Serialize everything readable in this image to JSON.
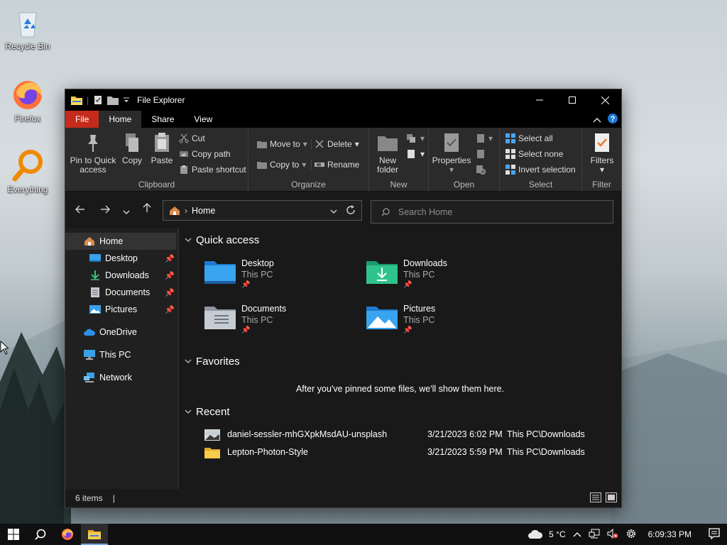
{
  "desktop": {
    "icons": [
      {
        "label": "Recycle Bin",
        "icon": "recycle-bin-icon"
      },
      {
        "label": "Firefox",
        "icon": "firefox-icon"
      },
      {
        "label": "Everything",
        "icon": "everything-search-icon"
      }
    ]
  },
  "window": {
    "title": "File Explorer",
    "controls": {
      "minimize": "minimize-icon",
      "maximize": "maximize-icon",
      "close": "close-icon"
    }
  },
  "tabs": {
    "file": "File",
    "home": "Home",
    "share": "Share",
    "view": "View"
  },
  "ribbon": {
    "clipboard": {
      "label": "Clipboard",
      "pin_line1": "Pin to Quick",
      "pin_line2": "access",
      "copy": "Copy",
      "paste": "Paste",
      "cut": "Cut",
      "copy_path": "Copy path",
      "paste_shortcut": "Paste shortcut"
    },
    "organize": {
      "label": "Organize",
      "move_to": "Move to",
      "copy_to": "Copy to",
      "delete": "Delete",
      "rename": "Rename"
    },
    "new": {
      "label": "New",
      "new_line1": "New",
      "new_line2": "folder"
    },
    "open": {
      "label": "Open",
      "properties": "Properties"
    },
    "select": {
      "label": "Select",
      "select_all": "Select all",
      "select_none": "Select none",
      "invert": "Invert selection"
    },
    "filter": {
      "label": "Filter",
      "filters": "Filters"
    }
  },
  "nav": {
    "address": "Home",
    "search_placeholder": "Search Home"
  },
  "sidebar": {
    "items": [
      {
        "label": "Home",
        "pinned": false
      },
      {
        "label": "Desktop",
        "pinned": true
      },
      {
        "label": "Downloads",
        "pinned": true
      },
      {
        "label": "Documents",
        "pinned": true
      },
      {
        "label": "Pictures",
        "pinned": true
      },
      {
        "label": "OneDrive",
        "pinned": false
      },
      {
        "label": "This PC",
        "pinned": false
      },
      {
        "label": "Network",
        "pinned": false
      }
    ]
  },
  "content": {
    "quick_access": {
      "header": "Quick access",
      "tiles": [
        {
          "name": "Desktop",
          "location": "This PC"
        },
        {
          "name": "Downloads",
          "location": "This PC"
        },
        {
          "name": "Documents",
          "location": "This PC"
        },
        {
          "name": "Pictures",
          "location": "This PC"
        }
      ]
    },
    "favorites": {
      "header": "Favorites",
      "empty_message": "After you've pinned some files, we'll show them here."
    },
    "recent": {
      "header": "Recent",
      "rows": [
        {
          "name": "daniel-sessler-mhGXpkMsdAU-unsplash",
          "date": "3/21/2023 6:02 PM",
          "location": "This PC\\Downloads"
        },
        {
          "name": "Lepton-Photon-Style",
          "date": "3/21/2023 5:59 PM",
          "location": "This PC\\Downloads"
        }
      ]
    }
  },
  "status": {
    "items": "6 items",
    "separator": "|"
  },
  "taskbar": {
    "weather": "5 °C",
    "time": "6:09:33 PM"
  },
  "colors": {
    "file_tab": "#c42b1c",
    "window_bg": "#191919",
    "ribbon_bg": "#2b2b2b",
    "accent": "#1e90ff"
  }
}
